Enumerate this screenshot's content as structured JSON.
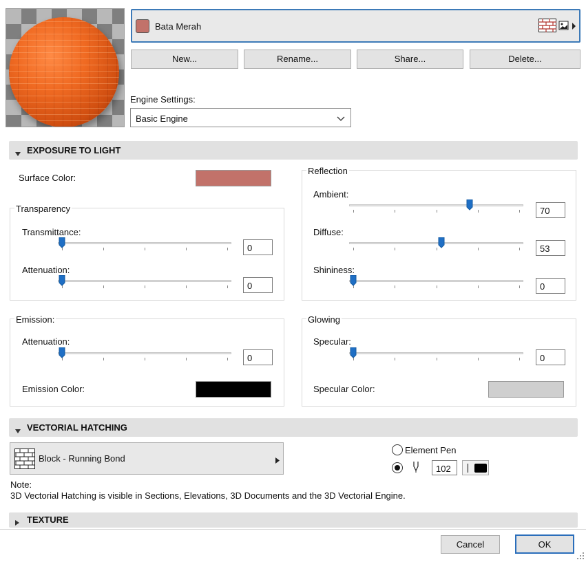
{
  "material": {
    "name": "Bata Merah",
    "swatch_color": "#c2726a"
  },
  "actions": {
    "new": "New...",
    "rename": "Rename...",
    "share": "Share...",
    "delete": "Delete..."
  },
  "engine": {
    "label": "Engine Settings:",
    "value": "Basic Engine"
  },
  "exposure": {
    "title": "EXPOSURE TO LIGHT",
    "surface_color_label": "Surface Color:",
    "surface_color": "#c2726a",
    "transparency": {
      "title": "Transparency",
      "transmittance_label": "Transmittance:",
      "transmittance": "0",
      "attenuation_label": "Attenuation:",
      "attenuation": "0"
    },
    "reflection": {
      "title": "Reflection",
      "ambient_label": "Ambient:",
      "ambient": "70",
      "diffuse_label": "Diffuse:",
      "diffuse": "53",
      "shininess_label": "Shininess:",
      "shininess": "0"
    },
    "emission": {
      "title": "Emission:",
      "attenuation_label": "Attenuation:",
      "attenuation": "0",
      "color_label": "Emission Color:",
      "color": "#000000"
    },
    "glowing": {
      "title": "Glowing",
      "specular_label": "Specular:",
      "specular": "0",
      "color_label": "Specular Color:",
      "color": "#cfcfcf"
    }
  },
  "hatching": {
    "title": "VECTORIAL HATCHING",
    "pattern": "Block - Running Bond",
    "element_pen_label": "Element Pen",
    "pen_number": "102",
    "note_label": "Note:",
    "note_text": "3D Vectorial Hatching is visible in Sections, Elevations, 3D Documents and the 3D Vectorial Engine."
  },
  "texture": {
    "title": "TEXTURE"
  },
  "footer": {
    "cancel": "Cancel",
    "ok": "OK"
  },
  "icons": [
    "brick-pattern-icon",
    "image-icon",
    "chevron-right-icon",
    "chevron-down-icon",
    "triangle-down-icon",
    "triangle-right-icon",
    "pen-icon",
    "resize-grip-icon"
  ]
}
